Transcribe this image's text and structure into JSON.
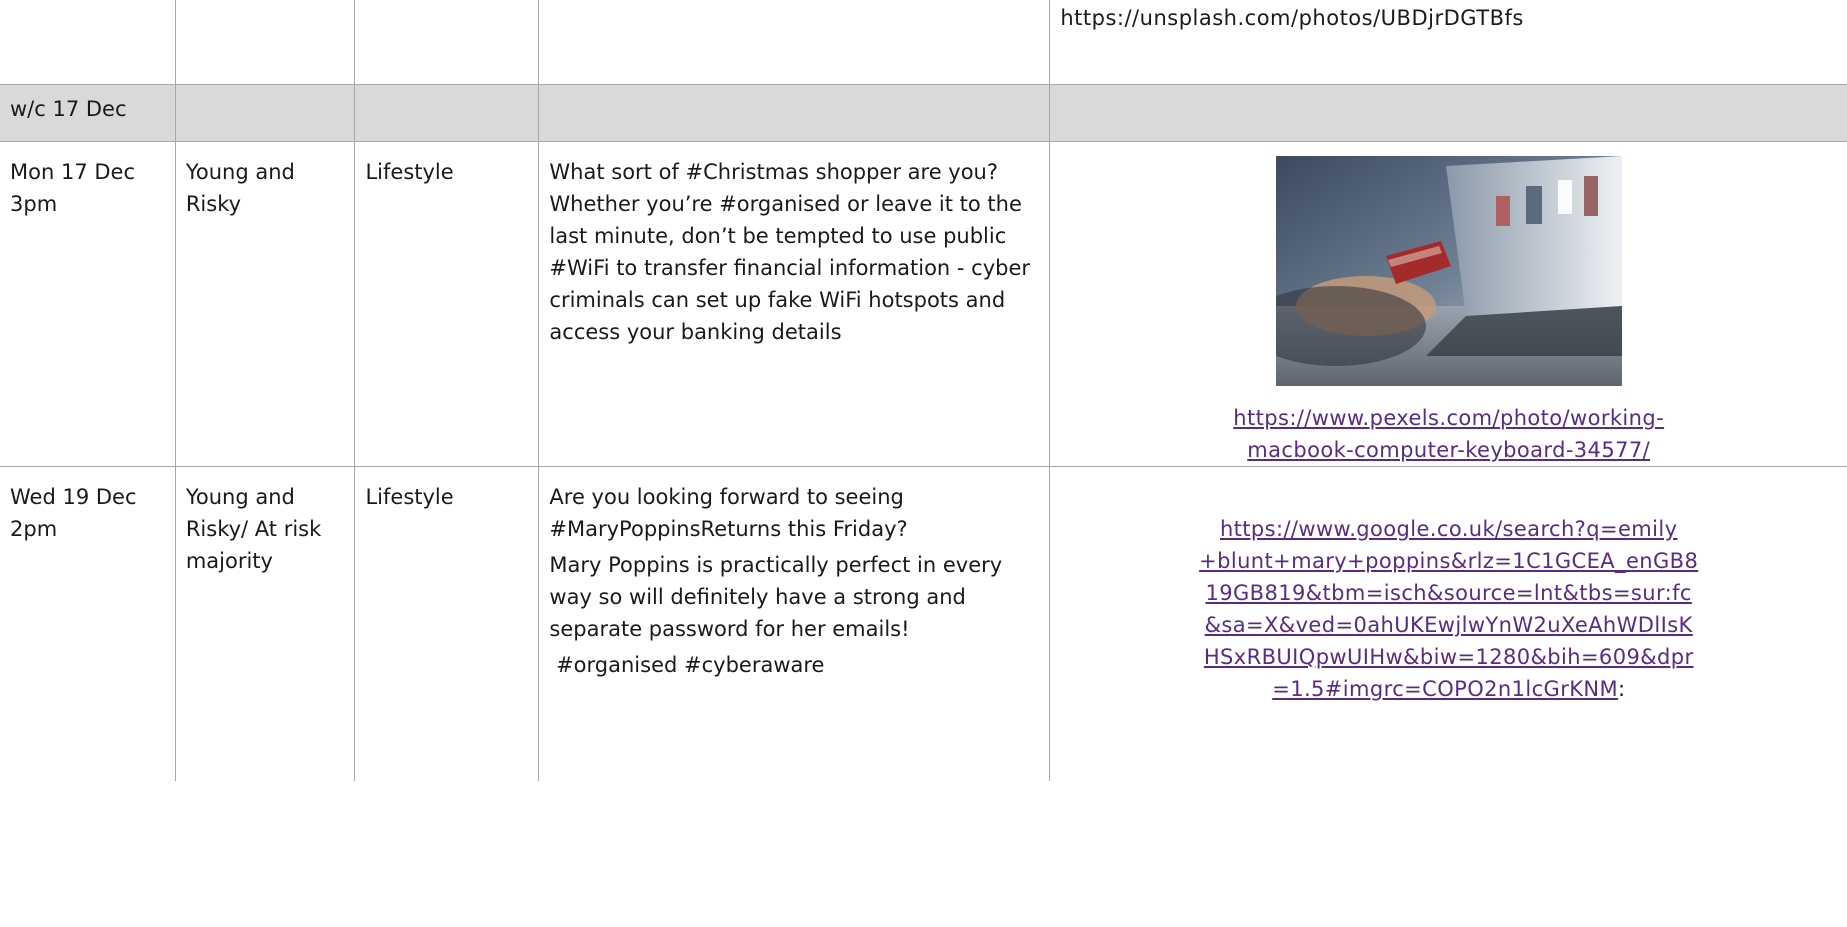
{
  "rows": {
    "top": {
      "url": "https://unsplash.com/photos/UBDjrDGTBfs"
    },
    "week": {
      "label": "w/c 17 Dec"
    },
    "mon": {
      "date": "Mon 17 Dec",
      "time": "3pm",
      "audience_line1": "Young and",
      "audience_line2": "Risky",
      "theme": "Lifestyle",
      "copy": "What sort of #Christmas shopper are you? Whether you’re #organised or leave it to the last minute, don’t be tempted to use public #WiFi to transfer financial information  - cyber criminals can set up fake WiFi hotspots and access your banking details",
      "image_link_line1": "https://www.pexels.com/photo/working-",
      "image_link_line2": "macbook-computer-keyboard-34577/"
    },
    "wed": {
      "date": "Wed 19 Dec",
      "time": "2pm",
      "audience_line1": "Young and",
      "audience_line2": "Risky/ At risk",
      "audience_line3": "majority",
      "theme": "Lifestyle",
      "copy_p1": "Are you looking forward to seeing #MaryPoppinsReturns this Friday?",
      "copy_p2": "Mary Poppins is practically perfect in every way so will definitely have a strong and separate password for her emails!",
      "copy_p3": " #organised #cyberaware",
      "image_link_lines": [
        "https://www.google.co.uk/search?q=emily",
        "+blunt+mary+poppins&rlz=1C1GCEA_enGB8",
        "19GB819&tbm=isch&source=lnt&tbs=sur:fc",
        "&sa=X&ved=0ahUKEwjlwYnW2uXeAhWDlIsK",
        "HSxRBUIQpwUIHw&biw=1280&bih=609&dpr",
        "=1.5#imgrc=COPO2n1lcGrKNM"
      ],
      "image_link_trailing": ":"
    }
  },
  "colors": {
    "link": "#5b2a86",
    "week_bg": "#d9d9d9",
    "border": "#a8a8a8"
  }
}
